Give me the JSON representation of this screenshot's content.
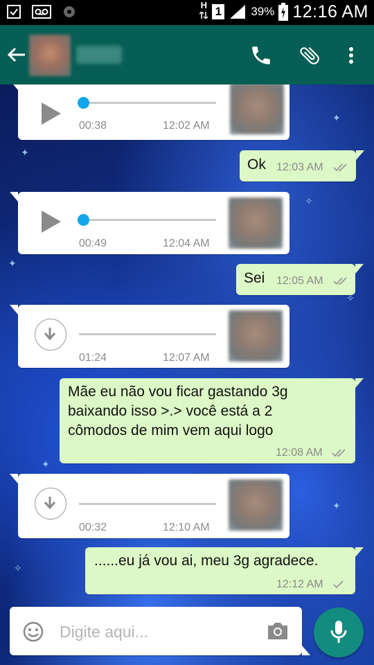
{
  "status_bar": {
    "network_letter": "H",
    "sim_slot": "1",
    "battery_percent": "39%",
    "clock": "12:16 AM",
    "icons": [
      "cast-icon",
      "voicemail-icon",
      "settings-icon",
      "data-arrows-icon",
      "signal-icon",
      "battery-charging-icon"
    ]
  },
  "toolbar": {
    "icons": [
      "back-arrow-icon",
      "phone-icon",
      "paperclip-icon",
      "more-vert-icon"
    ]
  },
  "messages": [
    {
      "type": "audio",
      "direction": "in",
      "state": "play",
      "duration": "00:38",
      "time": "12:02 AM"
    },
    {
      "type": "text",
      "direction": "out",
      "text": "Ok",
      "time": "12:03 AM",
      "status": "read"
    },
    {
      "type": "audio",
      "direction": "in",
      "state": "play",
      "duration": "00:49",
      "time": "12:04 AM"
    },
    {
      "type": "text",
      "direction": "out",
      "text": "Sei",
      "time": "12:05 AM",
      "status": "read"
    },
    {
      "type": "audio",
      "direction": "in",
      "state": "download",
      "duration": "01:24",
      "time": "12:07 AM"
    },
    {
      "type": "text",
      "direction": "out",
      "lines": [
        "Mãe eu não vou ficar gastando 3g",
        "baixando isso >.> você está a 2",
        "cômodos de mim vem aqui logo"
      ],
      "time": "12:08 AM",
      "status": "read"
    },
    {
      "type": "audio",
      "direction": "in",
      "state": "download",
      "duration": "00:32",
      "time": "12:10 AM"
    },
    {
      "type": "text",
      "direction": "out",
      "text": "......eu já vou ai, meu 3g agradece.",
      "time": "12:12 AM",
      "status": "sent"
    }
  ],
  "input": {
    "placeholder": "Digite aqui...",
    "value": "",
    "icons": [
      "emoji-icon",
      "camera-icon",
      "mic-icon"
    ]
  },
  "colors": {
    "toolbar": "#075e54",
    "outgoing_bubble": "#dcf8c6",
    "audio_knob": "#10a7ec",
    "mic_button": "#128c7e"
  }
}
